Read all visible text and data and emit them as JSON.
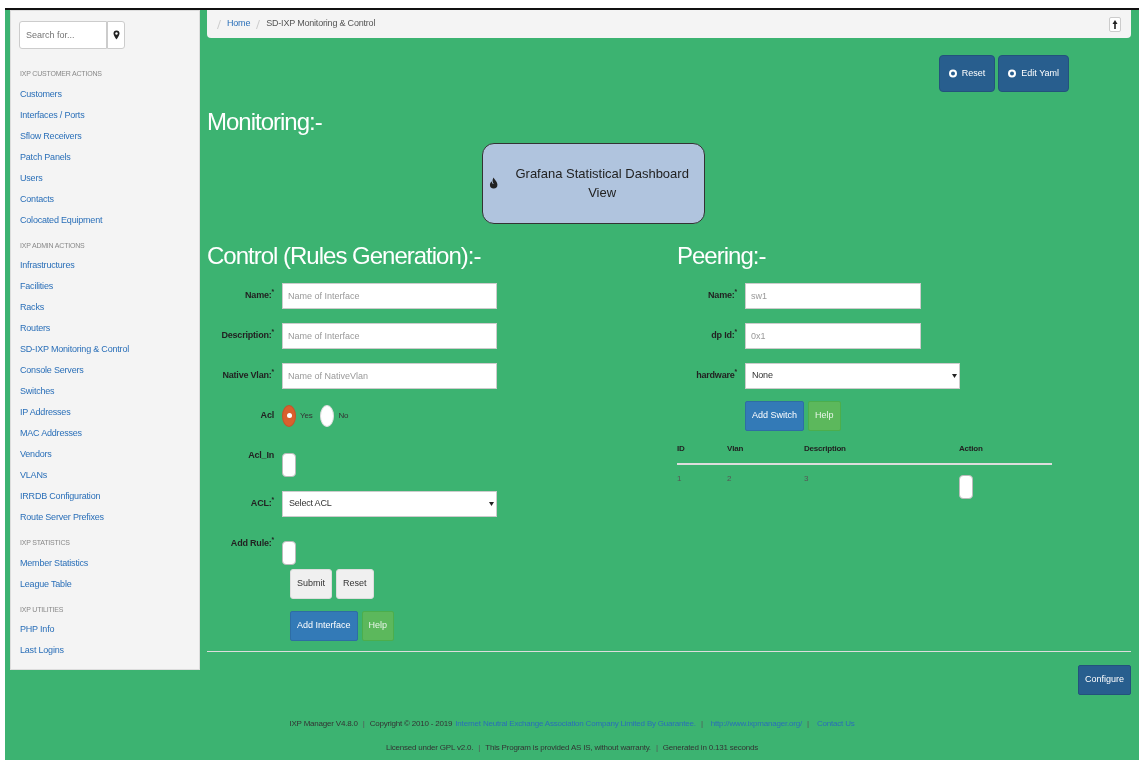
{
  "sidebar": {
    "search": {
      "placeholder": "Search for..."
    },
    "sections": [
      {
        "heading": "IXP CUSTOMER ACTIONS",
        "items": [
          "Customers",
          "Interfaces / Ports",
          "Sflow Receivers",
          "Patch Panels",
          "Users",
          "Contacts",
          "Colocated Equipment"
        ]
      },
      {
        "heading": "IXP ADMIN ACTIONS",
        "items": [
          "Infrastructures",
          "Facilities",
          "Racks",
          "Routers",
          "SD-IXP Monitoring & Control",
          "Console Servers",
          "Switches",
          "IP Addresses",
          "MAC Addresses",
          "Vendors",
          "VLANs",
          "IRRDB Configuration",
          "Route Server Prefixes"
        ]
      },
      {
        "heading": "IXP STATISTICS",
        "items": [
          "Member Statistics",
          "League Table"
        ]
      },
      {
        "heading": "IXP UTILITIES",
        "items": [
          "PHP Info",
          "Last Logins"
        ]
      }
    ]
  },
  "breadcrumb": [
    "Home",
    "SD-IXP Monitoring & Control"
  ],
  "toolbar_buttons": [
    "Reset",
    "Edit Yaml"
  ],
  "monitoring": {
    "title": "Monitoring:-",
    "dashboard_button": "Grafana Statistical Dashboard View"
  },
  "control": {
    "title": "Control (Rules Generation):-",
    "fields": [
      {
        "kind": "text",
        "label": "Name:$^{*}$",
        "placeholder": "Name of Interface"
      },
      {
        "kind": "text",
        "label": "Description:$^{*}$",
        "placeholder": "Name of Interface"
      },
      {
        "kind": "text",
        "label": "Native Vlan:$^{*}$",
        "placeholder": "Name of NativeVlan"
      },
      {
        "kind": "radio",
        "label": "Acl",
        "options": [
          {
            "label": "Yes",
            "selected": true
          },
          {
            "label": "No",
            "selected": false
          }
        ]
      },
      {
        "kind": "checkbox",
        "label": "Acl_In",
        "checked": false
      },
      {
        "kind": "select",
        "label": "ACL:$^{*}$",
        "value": "Select ACL"
      },
      {
        "kind": "checkbox",
        "label": "Add Rule:$^{*}$",
        "checked": false
      }
    ],
    "form_buttons": [
      "Submit",
      "Reset"
    ],
    "action_buttons": [
      {
        "label": "Add Interface",
        "kind": "primary"
      },
      {
        "label": "Help",
        "kind": "help"
      }
    ]
  },
  "peering": {
    "title": "Peering:-",
    "fields": [
      {
        "kind": "text",
        "label": "Name:$^{*}$",
        "placeholder": "sw1"
      },
      {
        "kind": "text",
        "label": "dp Id:$^{*}$",
        "placeholder": "0x1"
      },
      {
        "kind": "select",
        "label": "hardware$^{*}$",
        "value": "None"
      }
    ],
    "action_buttons": [
      {
        "label": "Add Switch",
        "kind": "primary"
      },
      {
        "label": "Help",
        "kind": "help"
      }
    ],
    "table": {
      "columns": [
        "ID",
        "Vlan",
        "Description",
        "Action"
      ],
      "rows": [
        {
          "cells": [
            "1",
            "2",
            "3"
          ],
          "checked": false
        }
      ]
    }
  },
  "configure_button": "Configure",
  "footer": [
    [
      {
        "kind": "text",
        "text": "IXP Manager V4.8.0"
      },
      {
        "kind": "sep",
        "text": "|"
      },
      {
        "kind": "text",
        "text": "Copyright © 2010 - 2019"
      },
      {
        "kind": "link",
        "text": "Internet Neutral Exchange Association Company Limited By Guarantee."
      },
      {
        "kind": "sep",
        "text": "|"
      },
      {
        "kind": "link",
        "text": "http://www.ixpmanager.org/"
      },
      {
        "kind": "sep",
        "text": "|"
      },
      {
        "kind": "link",
        "text": "Contact Us"
      }
    ],
    [
      {
        "kind": "text",
        "text": "Licensed under GPL v2.0."
      },
      {
        "kind": "sep",
        "text": "|"
      },
      {
        "kind": "text",
        "text": "This Program is provided AS IS, without warranty."
      },
      {
        "kind": "sep",
        "text": "|"
      },
      {
        "kind": "text",
        "text": "Generated in 0.131 seconds"
      }
    ]
  ]
}
